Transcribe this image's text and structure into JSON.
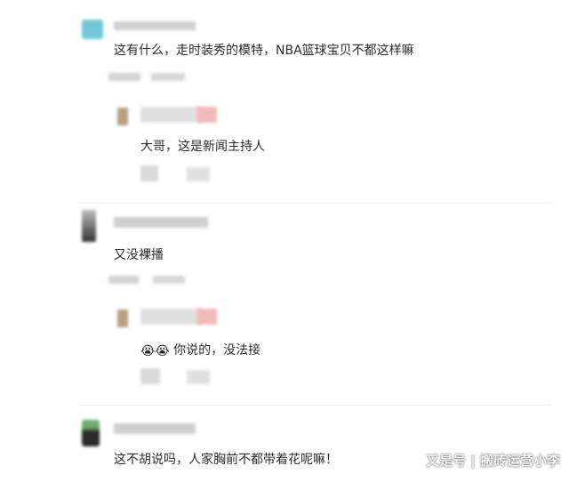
{
  "comments": [
    {
      "text": "这有什么，走时装秀的模特，NBA篮球宝贝不都这样嘛",
      "reply": {
        "text": "大哥，这是新闻主持人"
      }
    },
    {
      "text": "又没裸播",
      "reply": {
        "emojis": "😭😭",
        "text": "你说的，没法接"
      }
    },
    {
      "text": "这不胡说吗，人家胸前不都带着花呢嘛！"
    }
  ],
  "watermark": "又是号 | 搬砖运营小李",
  "colors": {
    "text": "#2b2b2b",
    "divider": "#ececec",
    "blur_gray": "#c9c9c9",
    "avatar_teal": "#6fc8d8",
    "avatar_dark": "#333333",
    "avatar_tan": "#b8a080",
    "name_pink": "#f2b9b9"
  }
}
